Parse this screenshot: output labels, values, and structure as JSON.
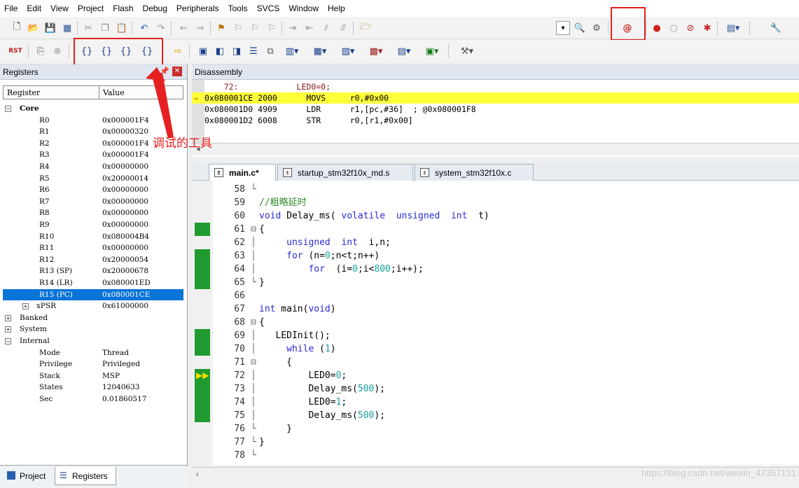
{
  "menu": [
    "File",
    "Edit",
    "View",
    "Project",
    "Flash",
    "Debug",
    "Peripherals",
    "Tools",
    "SVCS",
    "Window",
    "Help"
  ],
  "toolbar2_labels": {
    "rst": "RST"
  },
  "annotation_text": "调试的工具",
  "registers": {
    "title": "Registers",
    "col_register": "Register",
    "col_value": "Value",
    "rows": [
      {
        "name": "Core",
        "value": "",
        "level": 0,
        "exp": "−",
        "bold": true
      },
      {
        "name": "R0",
        "value": "0x000001F4",
        "level": 2
      },
      {
        "name": "R1",
        "value": "0x00000320",
        "level": 2
      },
      {
        "name": "R2",
        "value": "0x000001F4",
        "level": 2
      },
      {
        "name": "R3",
        "value": "0x000001F4",
        "level": 2
      },
      {
        "name": "R4",
        "value": "0x00000000",
        "level": 2
      },
      {
        "name": "R5",
        "value": "0x20000014",
        "level": 2
      },
      {
        "name": "R6",
        "value": "0x00000000",
        "level": 2
      },
      {
        "name": "R7",
        "value": "0x00000000",
        "level": 2
      },
      {
        "name": "R8",
        "value": "0x00000000",
        "level": 2
      },
      {
        "name": "R9",
        "value": "0x00000000",
        "level": 2
      },
      {
        "name": "R10",
        "value": "0x080004B4",
        "level": 2
      },
      {
        "name": "R11",
        "value": "0x00000000",
        "level": 2
      },
      {
        "name": "R12",
        "value": "0x20000054",
        "level": 2
      },
      {
        "name": "R13 (SP)",
        "value": "0x20000678",
        "level": 2
      },
      {
        "name": "R14 (LR)",
        "value": "0x080001ED",
        "level": 2
      },
      {
        "name": "R15 (PC)",
        "value": "0x080001CE",
        "level": 2,
        "selected": true
      },
      {
        "name": "xPSR",
        "value": "0x61000000",
        "level": 2,
        "exp": "+"
      },
      {
        "name": "Banked",
        "value": "",
        "level": 0,
        "exp": "+"
      },
      {
        "name": "System",
        "value": "",
        "level": 0,
        "exp": "+"
      },
      {
        "name": "Internal",
        "value": "",
        "level": 0,
        "exp": "−"
      },
      {
        "name": "Mode",
        "value": "Thread",
        "level": 2
      },
      {
        "name": "Privilege",
        "value": "Privileged",
        "level": 2
      },
      {
        "name": "Stack",
        "value": "MSP",
        "level": 2
      },
      {
        "name": "States",
        "value": "12040633",
        "level": 2
      },
      {
        "name": "Sec",
        "value": "0.01860517",
        "level": 2
      }
    ]
  },
  "disassembly": {
    "title": "Disassembly",
    "lines": [
      {
        "text": "    72:            LED0=0;",
        "color": "#8b1a1a",
        "hl": false,
        "arrow": false
      },
      {
        "text": "0x080001CE 2000      MOVS     r0,#0x00",
        "color": "#000",
        "hl": true,
        "arrow": true
      },
      {
        "text": "0x080001D0 4909      LDR      r1,[pc,#36]  ; @0x080001F8",
        "color": "#000",
        "hl": false,
        "arrow": false
      },
      {
        "text": "0x080001D2 6008      STR      r0,[r1,#0x00]",
        "color": "#000",
        "hl": false,
        "arrow": false
      }
    ]
  },
  "tabs": [
    {
      "label": "main.c*",
      "active": true
    },
    {
      "label": "startup_stm32f10x_md.s",
      "active": false
    },
    {
      "label": "system_stm32f10x.c",
      "active": false
    }
  ],
  "code": [
    {
      "ln": "58",
      "fold": "└",
      "html": ""
    },
    {
      "ln": "59",
      "fold": "",
      "html": "<span class='cm'>//粗略延时</span>"
    },
    {
      "ln": "60",
      "fold": "",
      "html": "<span class='kw'>void</span> Delay_ms( <span class='kw'>volatile</span>  <span class='kw'>unsigned</span>  <span class='kw'>int</span>  t)"
    },
    {
      "ln": "61",
      "fold": "⊟",
      "html": "{"
    },
    {
      "ln": "62",
      "fold": "│",
      "html": "     <span class='kw'>unsigned</span>  <span class='kw'>int</span>  i,n;"
    },
    {
      "ln": "63",
      "fold": "│",
      "html": "     <span class='kw'>for</span> (n=<span class='num'>0</span>;n&lt;t;n++)"
    },
    {
      "ln": "64",
      "fold": "│",
      "html": "         <span class='kw'>for</span>  (i=<span class='num'>0</span>;i&lt;<span class='num'>800</span>;i++);"
    },
    {
      "ln": "65",
      "fold": "└",
      "html": "}"
    },
    {
      "ln": "66",
      "fold": "",
      "html": ""
    },
    {
      "ln": "67",
      "fold": "",
      "html": "<span class='kw'>int</span> main(<span class='kw'>void</span>)"
    },
    {
      "ln": "68",
      "fold": "⊟",
      "html": "{"
    },
    {
      "ln": "69",
      "fold": "│",
      "html": "   LEDInit();"
    },
    {
      "ln": "70",
      "fold": "│",
      "html": "     <span class='kw'>while</span> (<span class='num'>1</span>)"
    },
    {
      "ln": "71",
      "fold": "⊟",
      "html": "     {"
    },
    {
      "ln": "72",
      "fold": "│",
      "html": "         LED0=<span class='num'>0</span>;"
    },
    {
      "ln": "73",
      "fold": "│",
      "html": "         Delay_ms(<span class='num'>500</span>);"
    },
    {
      "ln": "74",
      "fold": "│",
      "html": "         LED0=<span class='num'>1</span>;"
    },
    {
      "ln": "75",
      "fold": "│",
      "html": "         Delay_ms(<span class='num'>500</span>);"
    },
    {
      "ln": "76",
      "fold": "└",
      "html": "     }"
    },
    {
      "ln": "77",
      "fold": "└",
      "html": "}"
    },
    {
      "ln": "78",
      "fold": "└",
      "html": ""
    }
  ],
  "bottom_tabs": [
    "Project",
    "Registers"
  ],
  "watermark": "https://blog.csdn.net/weixin_47357131"
}
